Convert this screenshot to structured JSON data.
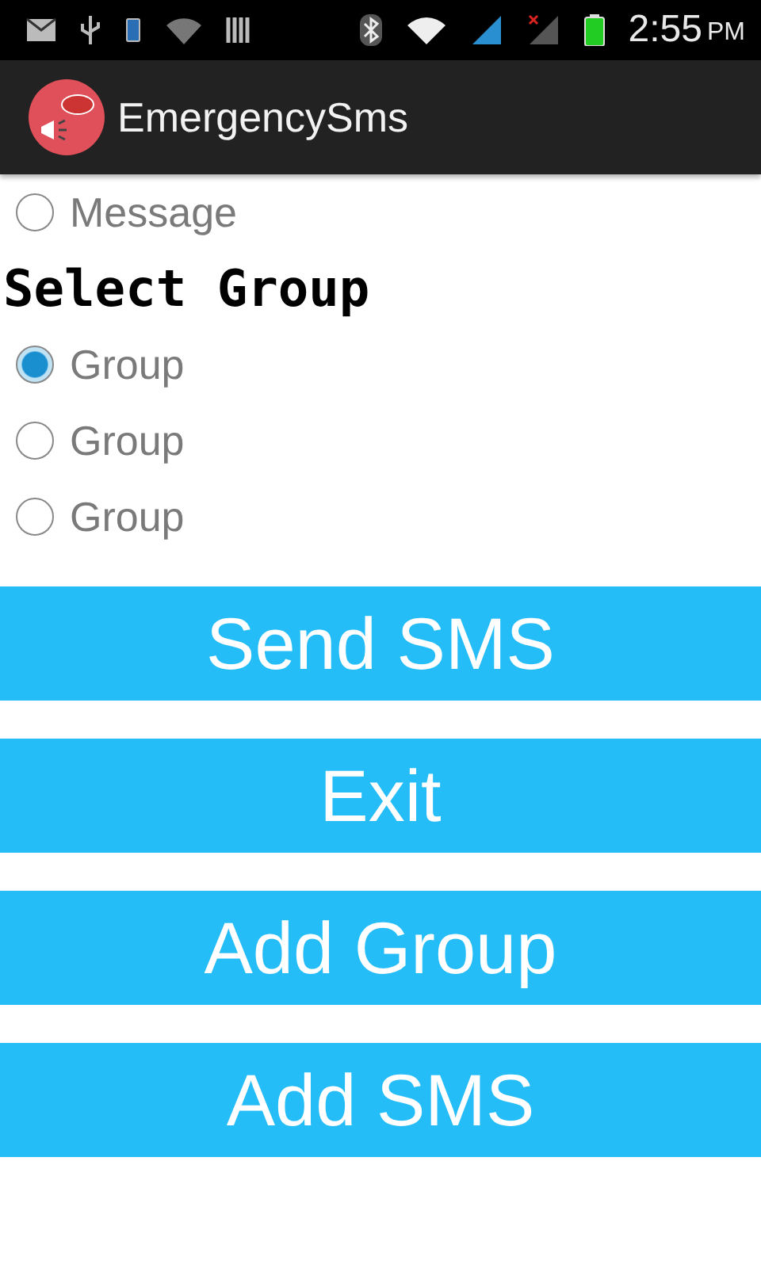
{
  "status_bar": {
    "time": "2:55",
    "period": "PM"
  },
  "app_bar": {
    "title": "EmergencySms"
  },
  "message_options": [
    {
      "label": "Message",
      "selected": false
    }
  ],
  "group_section": {
    "heading": "Select Group",
    "options": [
      {
        "label": "Group",
        "selected": true
      },
      {
        "label": "Group",
        "selected": false
      },
      {
        "label": "Group",
        "selected": false
      }
    ]
  },
  "buttons": [
    "Send SMS",
    "Exit",
    "Add Group",
    "Add SMS"
  ]
}
